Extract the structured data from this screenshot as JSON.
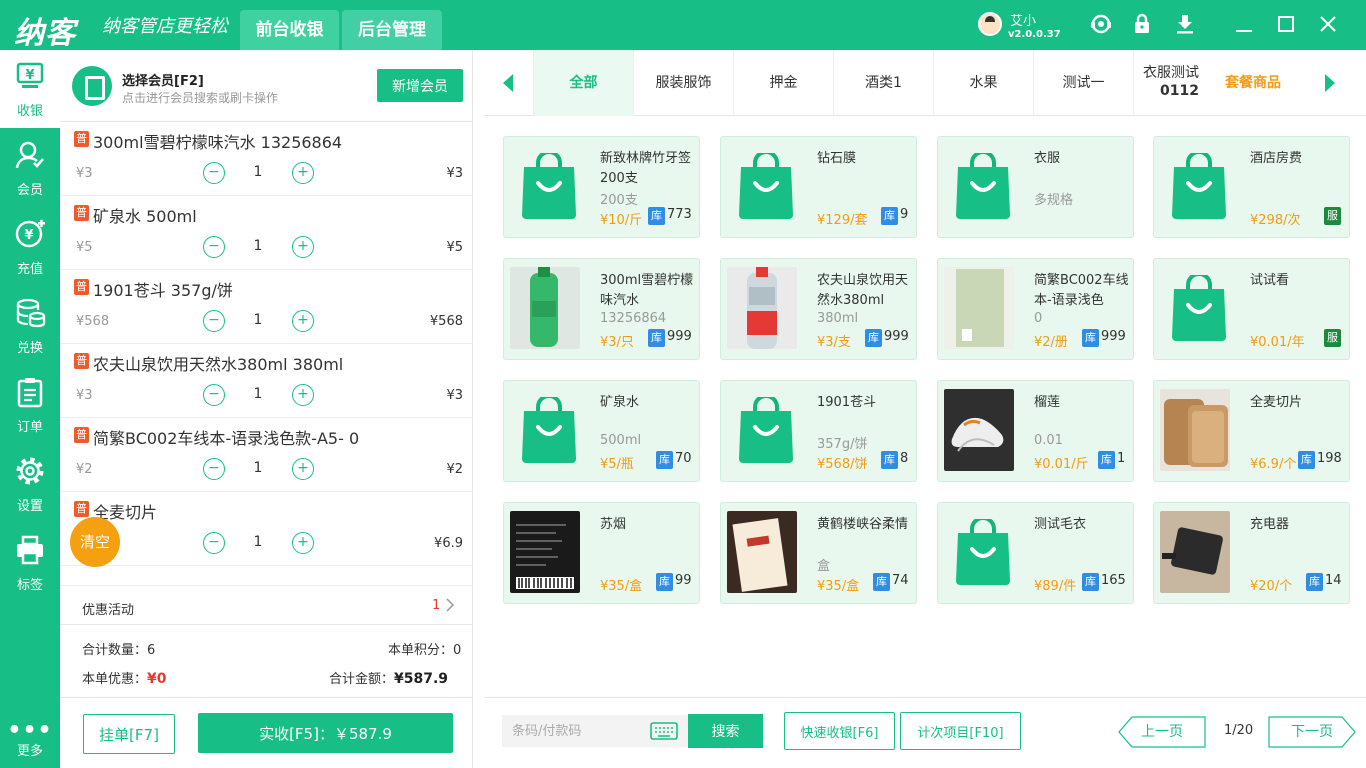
{
  "header": {
    "logo": "纳客",
    "slogan": "纳客管店更轻松",
    "tabs": [
      {
        "label": "前台收银",
        "active": true
      },
      {
        "label": "后台管理",
        "active": false
      }
    ],
    "user_name": "艾小",
    "version": "v2.0.0.37",
    "icons": [
      "support-icon",
      "lock-icon",
      "download-icon",
      "minimize-icon",
      "maximize-icon",
      "close-icon"
    ]
  },
  "sidebar": {
    "items": [
      {
        "label": "收银",
        "icon": "cashier-icon",
        "active": true
      },
      {
        "label": "会员",
        "icon": "member-icon"
      },
      {
        "label": "充值",
        "icon": "recharge-icon"
      },
      {
        "label": "兑换",
        "icon": "exchange-icon"
      },
      {
        "label": "订单",
        "icon": "order-icon"
      },
      {
        "label": "设置",
        "icon": "settings-icon"
      },
      {
        "label": "标签",
        "icon": "printer-icon"
      }
    ],
    "more": "更多"
  },
  "member": {
    "title": "选择会员[F2]",
    "subtitle": "点击进行会员搜索或刷卡操作",
    "add_button": "新增会员"
  },
  "cart": {
    "badge": "普",
    "items": [
      {
        "name": "300ml雪碧柠檬味汽水 13256864",
        "price": "¥3",
        "qty": "1",
        "total": "¥3"
      },
      {
        "name": "矿泉水 500ml",
        "price": "¥5",
        "qty": "1",
        "total": "¥5"
      },
      {
        "name": "1901苍斗 357g/饼",
        "price": "¥568",
        "qty": "1",
        "total": "¥568"
      },
      {
        "name": "农夫山泉饮用天然水380ml 380ml",
        "price": "¥3",
        "qty": "1",
        "total": "¥3"
      },
      {
        "name": "简繁BC002车线本-语录浅色款-A5- 0",
        "price": "¥2",
        "qty": "1",
        "total": "¥2"
      },
      {
        "name": "全麦切片",
        "price": "",
        "qty": "1",
        "total": "¥6.9"
      }
    ],
    "clear_button": "清空",
    "promo_label": "优惠活动",
    "promo_count": "1",
    "total_qty_label": "合计数量：",
    "total_qty": "6",
    "points_label": "本单积分：",
    "points": "0",
    "discount_label": "本单优惠：",
    "discount": "¥0",
    "total_amount_label": "合计金额：",
    "total_amount": "¥587.9",
    "hold_button": "挂单[F7]",
    "pay_button": "实收[F5]：￥587.9"
  },
  "categories": [
    {
      "label": "全部",
      "active": true
    },
    {
      "label": "服装服饰"
    },
    {
      "label": "押金"
    },
    {
      "label": "酒类1"
    },
    {
      "label": "水果"
    },
    {
      "label": "测试一"
    },
    {
      "label": "衣服测试",
      "label2": "0112"
    },
    {
      "label": "套餐商品",
      "package": true
    }
  ],
  "products": [
    {
      "name": "新致林牌竹牙签200支",
      "spec": "200支",
      "price": "¥10/斤",
      "stock_badge": "库",
      "stock": "773",
      "image": "bag"
    },
    {
      "name": "钻石膜",
      "spec": "",
      "price": "¥129/套",
      "stock_badge": "库",
      "stock": "9",
      "image": "bag"
    },
    {
      "name": "衣服",
      "spec": "多规格",
      "price": "",
      "stock_badge": "",
      "stock": "",
      "image": "bag"
    },
    {
      "name": "酒店房费",
      "spec": "",
      "price": "¥298/次",
      "service_badge": "服",
      "image": "bag"
    },
    {
      "name": "300ml雪碧柠檬味汽水",
      "spec": "13256864",
      "price": "¥3/只",
      "stock_badge": "库",
      "stock": "999",
      "image": "sprite"
    },
    {
      "name": "农夫山泉饮用天然水380ml",
      "spec": "380ml",
      "price": "¥3/支",
      "stock_badge": "库",
      "stock": "999",
      "image": "water"
    },
    {
      "name": "简繁BC002车线本-语录浅色",
      "spec": "0",
      "price": "¥2/册",
      "stock_badge": "库",
      "stock": "999",
      "image": "notebook"
    },
    {
      "name": "试试看",
      "spec": "",
      "price": "¥0.01/年",
      "service_badge": "服",
      "image": "bag"
    },
    {
      "name": "矿泉水",
      "spec": "500ml",
      "price": "¥5/瓶",
      "stock_badge": "库",
      "stock": "70",
      "image": "bag"
    },
    {
      "name": "1901苍斗",
      "spec": "357g/饼",
      "price": "¥568/饼",
      "stock_badge": "库",
      "stock": "8",
      "image": "bag"
    },
    {
      "name": "榴莲",
      "spec": "0.01",
      "price": "¥0.01/斤",
      "stock_badge": "库",
      "stock": "1",
      "image": "shoes"
    },
    {
      "name": "全麦切片",
      "spec": "",
      "price": "¥6.9/个",
      "stock_badge": "库",
      "stock": "198",
      "image": "bread"
    },
    {
      "name": "苏烟",
      "spec": "",
      "price": "¥35/盒",
      "stock_badge": "库",
      "stock": "99",
      "image": "cigarette"
    },
    {
      "name": "黄鹤楼峡谷柔情",
      "spec": "盒",
      "price": "¥35/盒",
      "stock_badge": "库",
      "stock": "74",
      "image": "pack"
    },
    {
      "name": "测试毛衣",
      "spec": "",
      "price": "¥89/件",
      "stock_badge": "库",
      "stock": "165",
      "image": "bag"
    },
    {
      "name": "充电器",
      "spec": "",
      "price": "¥20/个",
      "stock_badge": "库",
      "stock": "14",
      "image": "charger"
    }
  ],
  "bottom": {
    "scan_placeholder": "条码/付款码",
    "search_button": "搜索",
    "quick_button": "快速收银[F6]",
    "count_button": "计次项目[F10]",
    "prev_button": "上一页",
    "page": "1/20",
    "next_button": "下一页"
  },
  "colors": {
    "primary": "#17bf87",
    "price": "#f39c12",
    "badge_pu": "#f05a28",
    "stock_badge": "#2f8de4",
    "service_badge": "#1a8a3f",
    "clear": "#f5a010"
  }
}
